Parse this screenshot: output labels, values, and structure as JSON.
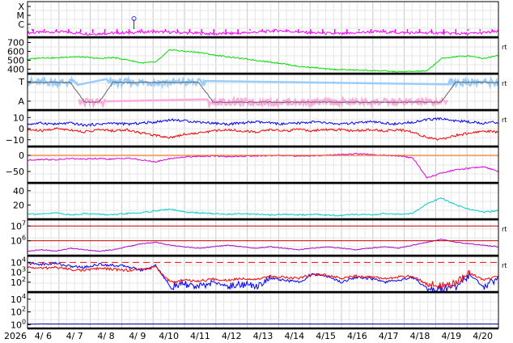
{
  "chart_data": [
    {
      "type": "line",
      "panel_id": "xray_class",
      "ylabels": [
        "X",
        "M",
        "C"
      ],
      "series": [
        {
          "color": "#ff00ff",
          "values": [
            1.4,
            1.5,
            1.3,
            1.4,
            1.5,
            1.4,
            1.3,
            1.4,
            1.6,
            1.4,
            1.3,
            1.5,
            1.4,
            1.4,
            1.3,
            1.5
          ]
        }
      ],
      "marker_glyph": "circle-on-stick"
    },
    {
      "type": "line",
      "panel_id": "solar_wind_speed",
      "yticks": [
        "700",
        "600",
        "500",
        "400"
      ],
      "ylim": [
        350,
        750
      ],
      "side_label": "rt",
      "series": [
        {
          "color": "#00dd00",
          "values": [
            510,
            530,
            525,
            540,
            535,
            520,
            530,
            505,
            470,
            480,
            620,
            600,
            590,
            560,
            540,
            520,
            500,
            480,
            460,
            430,
            420,
            400,
            395,
            390,
            385,
            380,
            370,
            375,
            380,
            520,
            540,
            550,
            520,
            560
          ]
        }
      ]
    },
    {
      "type": "line",
      "panel_id": "magnetic_sector",
      "ylabels": [
        "T",
        "A"
      ],
      "side_label": "rt",
      "series": [
        {
          "color": "#99ccff",
          "name": "",
          "values": [
            1,
            1,
            1,
            1,
            0,
            0,
            1,
            1,
            1,
            1,
            1,
            1,
            1,
            0,
            0,
            0,
            0,
            0,
            0,
            0,
            0,
            0,
            0,
            0,
            0,
            0,
            0,
            0,
            0,
            0,
            1,
            1,
            1,
            1
          ]
        },
        {
          "color": "#ffaadd",
          "name": "",
          "values": [
            0,
            0,
            0,
            0,
            1,
            1,
            0,
            0,
            0,
            0,
            0,
            0,
            0,
            1,
            1,
            1,
            1,
            1,
            1,
            1,
            1,
            1,
            1,
            1,
            1,
            1,
            1,
            1,
            1,
            1,
            0,
            0,
            0,
            0
          ]
        },
        {
          "color": "#666666",
          "name": "",
          "values": [
            1,
            1,
            1,
            1,
            0,
            0,
            1,
            1,
            1,
            1,
            1,
            1,
            1,
            0,
            0,
            0,
            0,
            0,
            0,
            0,
            0,
            0,
            0,
            0,
            0,
            0,
            0,
            0,
            0,
            0,
            1,
            1,
            1,
            1
          ]
        }
      ]
    },
    {
      "type": "line",
      "panel_id": "imf",
      "yticks": [
        "10",
        "0",
        "−10"
      ],
      "ylim": [
        -16,
        16
      ],
      "side_label": "rt",
      "series": [
        {
          "color": "#0000ff",
          "values": [
            4,
            5,
            4,
            5,
            3,
            4,
            5,
            4,
            5,
            6,
            8,
            7,
            6,
            5,
            4,
            5,
            6,
            5,
            4,
            5,
            6,
            5,
            4,
            5,
            6,
            5,
            4,
            6,
            8,
            9,
            7,
            6,
            5,
            6
          ]
        },
        {
          "color": "#ff0000",
          "values": [
            -1,
            -2,
            0,
            -1,
            -3,
            -1,
            -2,
            -1,
            -4,
            -6,
            -8,
            -5,
            -4,
            -2,
            -1,
            -2,
            -3,
            -1,
            -2,
            -1,
            -2,
            -1,
            -1,
            -2,
            -1,
            -2,
            -1,
            -3,
            -8,
            -10,
            -6,
            -4,
            -2,
            -3
          ]
        }
      ]
    },
    {
      "type": "line",
      "panel_id": "dst",
      "yticks": [
        "0",
        "−50"
      ],
      "ylim": [
        -85,
        25
      ],
      "series": [
        {
          "color": "#dd00dd",
          "values": [
            -15,
            -12,
            -14,
            -10,
            -12,
            -10,
            -12,
            -8,
            -15,
            -20,
            -10,
            -5,
            -3,
            -2,
            -4,
            -3,
            -2,
            -1,
            0,
            -2,
            -1,
            0,
            2,
            5,
            3,
            0,
            -2,
            -8,
            -70,
            -55,
            -45,
            -40,
            -35,
            -50
          ]
        },
        {
          "color": "#ff6600",
          "values": [
            0,
            0
          ]
        }
      ]
    },
    {
      "type": "line",
      "panel_id": "kp_index",
      "yticks": [
        "40",
        "20"
      ],
      "ylim": [
        0,
        50
      ],
      "series": [
        {
          "color": "#00cccc",
          "values": [
            8,
            7,
            9,
            6,
            8,
            7,
            6,
            8,
            9,
            12,
            14,
            10,
            9,
            8,
            7,
            8,
            7,
            6,
            7,
            6,
            7,
            6,
            5,
            7,
            6,
            8,
            7,
            8,
            22,
            30,
            20,
            14,
            10,
            12
          ]
        }
      ]
    },
    {
      "type": "line",
      "panel_id": "electron_flux",
      "yticks_pow": [
        "7",
        "6"
      ],
      "side_label": "rt",
      "series": [
        {
          "color": "#aa00cc",
          "values": [
            5.3,
            5.4,
            5.3,
            5.5,
            5.4,
            5.3,
            5.4,
            5.6,
            5.8,
            5.9,
            5.7,
            5.6,
            5.5,
            5.6,
            5.7,
            5.6,
            5.5,
            5.6,
            5.5,
            5.4,
            5.5,
            5.6,
            5.5,
            5.4,
            5.5,
            5.6,
            5.5,
            5.7,
            5.9,
            6.1,
            5.9,
            5.8,
            5.7,
            5.6
          ]
        },
        {
          "color": "#cc0000",
          "values": [
            7,
            7
          ]
        },
        {
          "color": "#cc0000",
          "values": [
            6,
            6
          ]
        }
      ]
    },
    {
      "type": "line",
      "panel_id": "proton_flux",
      "yticks_pow": [
        "4",
        "3",
        "2"
      ],
      "side_label": "rt",
      "series": [
        {
          "color": "#0000ff",
          "values": [
            3.9,
            3.8,
            3.9,
            3.6,
            3.5,
            3.8,
            3.7,
            3.6,
            3.2,
            3.7,
            1.5,
            1.8,
            1.5,
            2.0,
            1.6,
            1.8,
            1.6,
            2.4,
            2.2,
            2.0,
            2.8,
            2.6,
            2.0,
            2.5,
            2.4,
            2.0,
            2.2,
            2.5,
            1.4,
            1.3,
            1.5,
            2.8,
            1.5,
            2.5
          ]
        },
        {
          "color": "#ff0000",
          "values": [
            3.5,
            3.4,
            3.5,
            3.3,
            3.2,
            3.4,
            3.3,
            3.2,
            3.3,
            3.5,
            2.0,
            2.2,
            2.1,
            2.3,
            2.2,
            2.4,
            2.3,
            2.6,
            2.5,
            2.4,
            2.8,
            2.7,
            2.4,
            2.6,
            2.5,
            2.4,
            2.5,
            2.6,
            1.8,
            1.7,
            1.9,
            2.9,
            2.2,
            2.6
          ]
        },
        {
          "color": "#ff0000",
          "values": [
            4,
            4
          ]
        }
      ]
    },
    {
      "type": "line",
      "panel_id": "neutron",
      "yticks_pow": [
        "4",
        "2",
        "0"
      ],
      "series": [
        {
          "color": "#0000aa",
          "values": [
            0.1,
            0.1,
            0.1,
            0.1,
            0.1,
            0.1,
            0.1,
            0.1,
            0.1,
            0.1,
            0.1,
            0.1,
            0.1,
            0.1,
            0.1,
            0.1,
            0.1,
            0.1,
            0.1,
            0.1,
            0.1,
            0.1,
            0.1,
            0.1,
            0.1,
            0.1,
            0.1,
            0.1,
            0.1,
            0.1,
            0.1,
            0.1,
            0.1,
            0.1
          ]
        }
      ]
    }
  ],
  "xaxis": {
    "year": "2026",
    "ticks": [
      "4/ 6",
      "4/ 7",
      "4/ 8",
      "4/ 9",
      "4/10",
      "4/11",
      "4/12",
      "4/13",
      "4/14",
      "4/15",
      "4/16",
      "4/17",
      "4/18",
      "4/19",
      "4/20"
    ]
  }
}
